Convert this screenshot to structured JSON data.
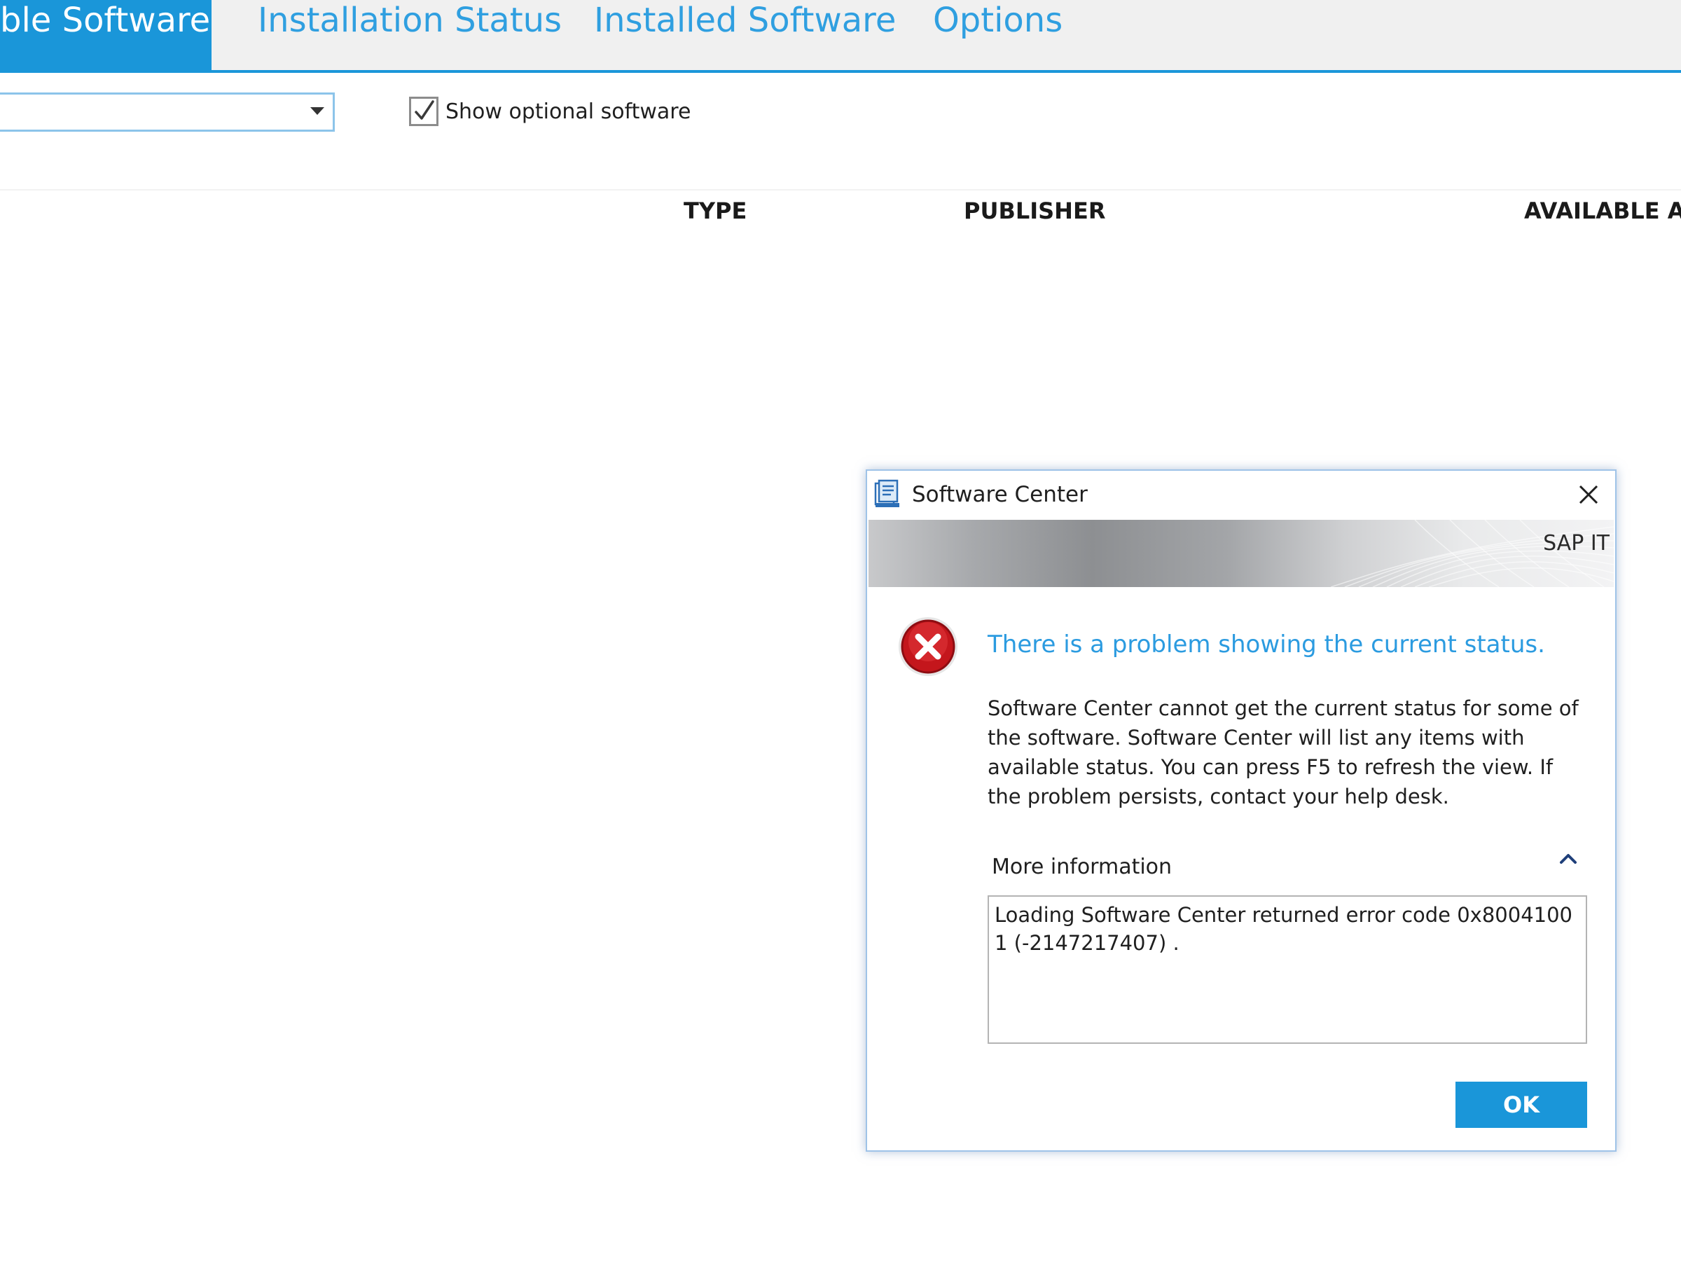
{
  "tabs": [
    {
      "label": "ble Software",
      "active": true
    },
    {
      "label": "Installation Status",
      "active": false
    },
    {
      "label": "Installed Software",
      "active": false
    },
    {
      "label": "Options",
      "active": false
    }
  ],
  "filter": {
    "selected_value": "",
    "show_optional_label": "Show optional software",
    "show_optional_checked": true
  },
  "table": {
    "columns": [
      "TYPE",
      "PUBLISHER",
      "AVAILABLE AFT"
    ],
    "rows": []
  },
  "dialog": {
    "title": "Software Center",
    "app_icon": "software-center-icon",
    "banner_brand": "SAP IT",
    "status_icon": "error-icon",
    "heading": "There is a problem showing the current status.",
    "message": "Software Center cannot get the current status for some of the software.  Software Center will list any items with available status.  You can press F5 to refresh the view.  If the problem persists, contact your help desk.",
    "more_info_label": "More information",
    "more_info_expanded": true,
    "details": "Loading Software Center returned error code 0x80041001 (-2147217407) .",
    "ok_label": "OK"
  },
  "colors": {
    "accent": "#1a96d9",
    "tab_text": "#2f9fe0",
    "heading_text": "#2b9be0",
    "error_red": "#c4161c"
  }
}
